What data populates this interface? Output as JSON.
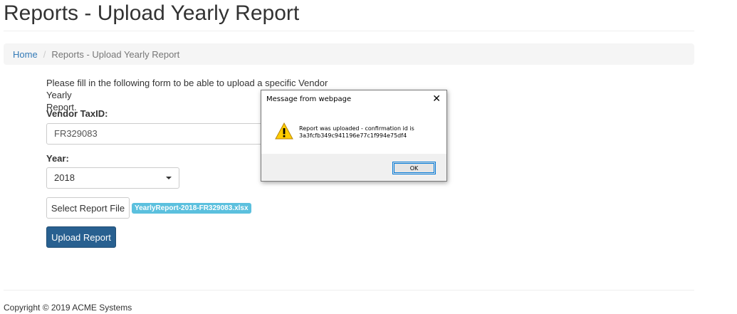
{
  "page": {
    "title": "Reports - Upload Yearly Report"
  },
  "breadcrumb": {
    "home": "Home",
    "separator": "/",
    "current": "Reports - Upload Yearly Report"
  },
  "form": {
    "intro_line1": "Please fill in the following form to be able to upload a specific Vendor Yearly",
    "intro_line2": "Report.",
    "vendor_label": "Vendor TaxID:",
    "vendor_value": "FR329083",
    "year_label": "Year:",
    "year_value": "2018",
    "select_file_label": "Select Report File",
    "file_name": "YearlyReport-2018-FR329083.xlsx",
    "upload_label": "Upload Report"
  },
  "footer": {
    "copyright": "Copyright © 2019 ACME Systems"
  },
  "dialog": {
    "title": "Message from webpage",
    "close_glyph": "✕",
    "message_line1": "Report was uploaded - confirmation id is",
    "message_line2": "3a3fcfb349c941196e77c1f994e75df4",
    "ok_label": "OK",
    "icon": "warning-icon"
  },
  "colors": {
    "link": "#337ab7",
    "primary_button": "#286090",
    "file_badge": "#5bc0de",
    "warning": "#ffcc00"
  }
}
